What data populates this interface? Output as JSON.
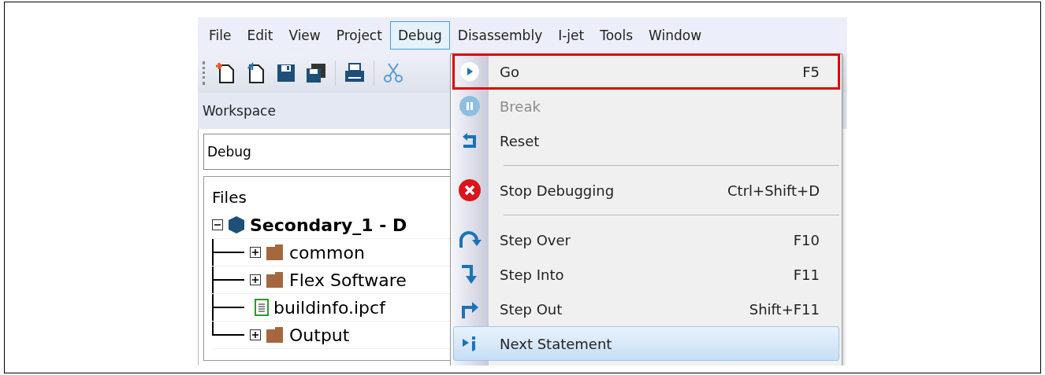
{
  "menu_bar": [
    {
      "label": "File",
      "selected": false
    },
    {
      "label": "Edit",
      "selected": false
    },
    {
      "label": "View",
      "selected": false
    },
    {
      "label": "Project",
      "selected": false
    },
    {
      "label": "Debug",
      "selected": true
    },
    {
      "label": "Disassembly",
      "selected": false
    },
    {
      "label": "I-jet",
      "selected": false
    },
    {
      "label": "Tools",
      "selected": false
    },
    {
      "label": "Window",
      "selected": false
    }
  ],
  "workspace": {
    "title": "Workspace",
    "configuration": "Debug",
    "files_header": "Files",
    "tree": [
      {
        "label": "Secondary_1 - D",
        "kind": "project",
        "expanded": true,
        "children": [
          {
            "label": "common",
            "kind": "folder",
            "expanded": false
          },
          {
            "label": "Flex Software",
            "kind": "folder",
            "expanded": false
          },
          {
            "label": "buildinfo.ipcf",
            "kind": "file"
          },
          {
            "label": "Output",
            "kind": "folder",
            "expanded": false
          }
        ]
      }
    ]
  },
  "debug_menu": [
    {
      "kind": "item",
      "label": "Go",
      "shortcut": "F5",
      "disabled": false,
      "selected": false,
      "highlighted": true
    },
    {
      "kind": "item",
      "label": "Break",
      "disabled": true,
      "selected": false,
      "highlighted": false
    },
    {
      "kind": "item",
      "label": "Reset",
      "disabled": false,
      "selected": false,
      "highlighted": false
    },
    {
      "kind": "separator"
    },
    {
      "kind": "item",
      "label": "Stop Debugging",
      "shortcut": "Ctrl+Shift+D",
      "disabled": false,
      "selected": false,
      "highlighted": false
    },
    {
      "kind": "separator"
    },
    {
      "kind": "item",
      "label": "Step Over",
      "shortcut": "F10",
      "disabled": false,
      "selected": false,
      "highlighted": false
    },
    {
      "kind": "item",
      "label": "Step Into",
      "shortcut": "F11",
      "disabled": false,
      "selected": false,
      "highlighted": false
    },
    {
      "kind": "item",
      "label": "Step Out",
      "shortcut": "Shift+F11",
      "disabled": false,
      "selected": false,
      "highlighted": false
    },
    {
      "kind": "item",
      "label": "Next Statement",
      "disabled": false,
      "selected": true,
      "highlighted": false
    }
  ]
}
